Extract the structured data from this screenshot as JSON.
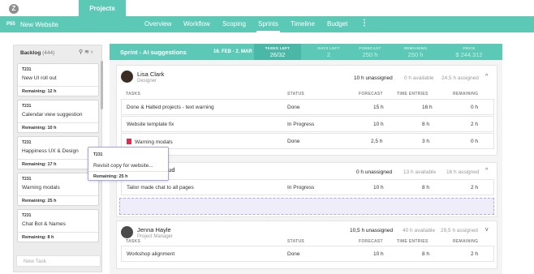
{
  "header": {
    "logo_letter": "Z",
    "projects_tab": "Projects",
    "project_code": "P55",
    "project_name": "New Website",
    "tabs": [
      {
        "label": "Overview"
      },
      {
        "label": "Workflow"
      },
      {
        "label": "Scoping"
      },
      {
        "label": "Sprints"
      },
      {
        "label": "Timeline"
      },
      {
        "label": "Budget"
      }
    ],
    "more": "⋮"
  },
  "backlog": {
    "title": "Backlog",
    "count": "(444)",
    "cards": [
      {
        "code": "T231",
        "title": "New UI roll out",
        "remaining": "Remaining: 12 h"
      },
      {
        "code": "T231",
        "title": "Calendar view suggestion",
        "remaining": "Remaining: 10 h"
      },
      {
        "code": "T231",
        "title": "Happiness UX & Design",
        "remaining": "Remaining: 17 h"
      },
      {
        "code": "T231",
        "title": "Warning modals",
        "remaining": "Remaining: 25 h"
      },
      {
        "code": "T231",
        "title": "Chat Bot & Names",
        "remaining": "Remaining: 8 h"
      }
    ],
    "new_task_placeholder": "New Task"
  },
  "drag_card": {
    "code": "T231",
    "title": "Revisit copy for website...",
    "remaining": "Remaining: 25 h"
  },
  "sprint": {
    "name": "Sprint - AI suggestions",
    "dates": "16. FEB - 2. MAR",
    "stats": [
      {
        "label": "TASKS LEFT",
        "value": "26/32"
      },
      {
        "label": "DAYS LEFT",
        "value": "2"
      },
      {
        "label": "FORECAST",
        "value": "250 h"
      },
      {
        "label": "REMAINING",
        "value": "250 h"
      },
      {
        "label": "PRICE",
        "value": "$ 244.312"
      }
    ],
    "collapse": "^"
  },
  "columns": {
    "tasks": "TASKS",
    "status": "STATUS",
    "forecast": "FORECAST",
    "time_entries": "TIME ENTRIES",
    "remaining": "REMAINING"
  },
  "people": [
    {
      "name": "Lisa Clark",
      "role": "Designer",
      "unassigned": "10 h unassigned",
      "available": "0 h available",
      "assigned": "24,5 h assigned",
      "tasks": [
        {
          "name": "Done & Halted projects - text warning",
          "status": "Done",
          "forecast": "15 h",
          "time": "16 h",
          "remaining": "0 h"
        },
        {
          "name": "Website template fix",
          "status": "In Progress",
          "forecast": "10 h",
          "time": "8 h",
          "remaining": "2 h"
        },
        {
          "name": "Warning modals",
          "status": "Done",
          "forecast": "2,5 h",
          "time": "3 h",
          "remaining": "0 h"
        }
      ]
    },
    {
      "name": "...ud",
      "role": "",
      "unassigned": "0 h unassigned",
      "available": "13 h available",
      "assigned": "16 h assigned",
      "tasks": [
        {
          "name": "Tailor made chat to all pages",
          "status": "In Progress",
          "forecast": "10 h",
          "time": "8 h",
          "remaining": "2 h"
        }
      ]
    },
    {
      "name": "Jenna Hayle",
      "role": "Project Manager",
      "unassigned": "10,5 h unassigned",
      "available": "40 h available",
      "assigned": "29,5 h assigned",
      "tasks": [
        {
          "name": "Workshop alignment",
          "status": "Done",
          "forecast": "10 h",
          "time": "8 h",
          "remaining": "2 h"
        }
      ]
    }
  ]
}
